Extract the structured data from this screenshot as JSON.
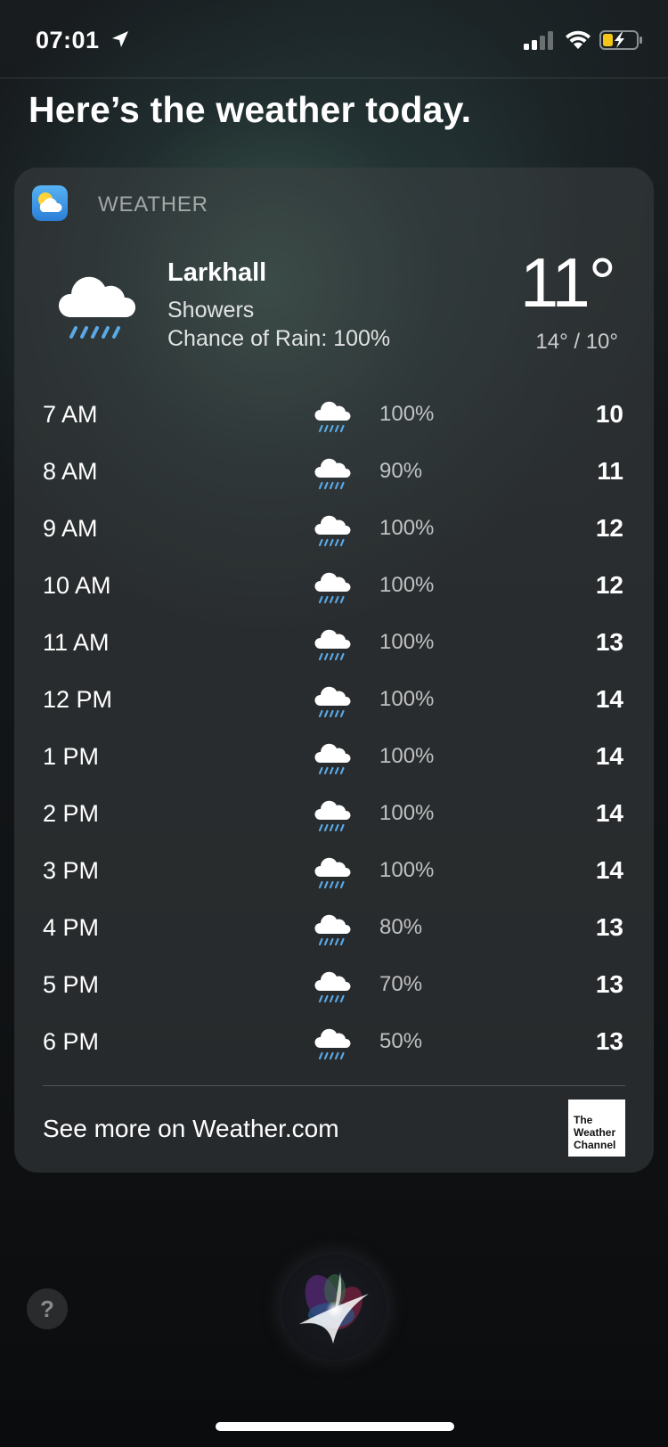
{
  "status_bar": {
    "time": "07:01"
  },
  "headline": "Here’s the weather today.",
  "card": {
    "app_name": "WEATHER",
    "location": "Larkhall",
    "condition": "Showers",
    "chance_of_rain": "Chance of Rain: 100%",
    "current_temp": "11°",
    "high_low": "14° / 10°",
    "hourly": [
      {
        "hour": "7 AM",
        "pct": "100%",
        "temp": "10"
      },
      {
        "hour": "8 AM",
        "pct": "90%",
        "temp": "11"
      },
      {
        "hour": "9 AM",
        "pct": "100%",
        "temp": "12"
      },
      {
        "hour": "10 AM",
        "pct": "100%",
        "temp": "12"
      },
      {
        "hour": "11 AM",
        "pct": "100%",
        "temp": "13"
      },
      {
        "hour": "12 PM",
        "pct": "100%",
        "temp": "14"
      },
      {
        "hour": "1 PM",
        "pct": "100%",
        "temp": "14"
      },
      {
        "hour": "2 PM",
        "pct": "100%",
        "temp": "14"
      },
      {
        "hour": "3 PM",
        "pct": "100%",
        "temp": "14"
      },
      {
        "hour": "4 PM",
        "pct": "80%",
        "temp": "13"
      },
      {
        "hour": "5 PM",
        "pct": "70%",
        "temp": "13"
      },
      {
        "hour": "6 PM",
        "pct": "50%",
        "temp": "13"
      }
    ],
    "hourly_icon": "rain-cloud-icon",
    "see_more": "See more on Weather.com",
    "provider_logo_lines": [
      "The",
      "Weather",
      "Channel"
    ]
  },
  "help_label": "?",
  "colors": {
    "rain_drops": "#5aa9e6",
    "battery_fill": "#f5c518"
  }
}
